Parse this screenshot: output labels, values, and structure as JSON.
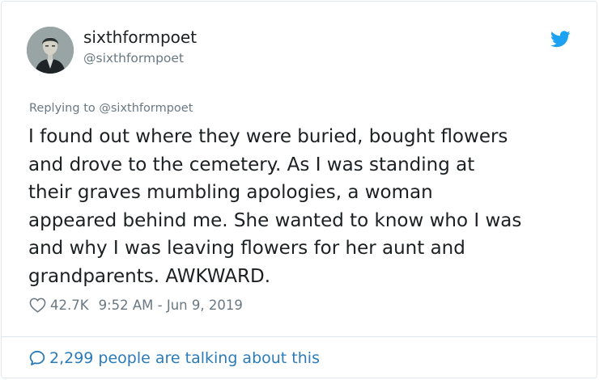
{
  "author": {
    "display_name": "sixthformpoet",
    "handle": "@sixthformpoet"
  },
  "tweet": {
    "replying_to": "Replying to @sixthformpoet",
    "lines": [
      "I found out where they were buried, bought flowers",
      "and drove to the cemetery. As I was standing at",
      "their graves mumbling apologies, a woman",
      "appeared behind me. She wanted to know who I was",
      "and why I was leaving flowers for her aunt and",
      "grandparents. AWKWARD."
    ],
    "like_count": "42.7K",
    "timestamp": "9:52 AM - Jun 9, 2019"
  },
  "footer": {
    "talking_label": "2,299 people are talking about this"
  },
  "icons": {
    "brand": "twitter-bird-icon",
    "like": "heart-icon",
    "conversation": "speech-bubble-icon"
  },
  "colors": {
    "brand_blue": "#1da1f2",
    "link_blue": "#2b7bb9",
    "muted_text": "#697882",
    "body_text": "#1c2022",
    "border": "#e1e8ed"
  }
}
